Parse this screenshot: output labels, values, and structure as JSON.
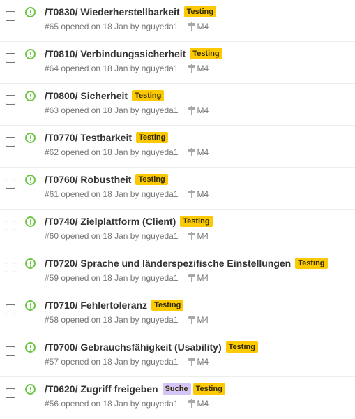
{
  "colors": {
    "open_icon": "#6cc644",
    "testing_label_bg": "#fbca04",
    "testing_label_fg": "#332900",
    "suche_label_bg": "#d4c5f9",
    "suche_label_fg": "#332900"
  },
  "issues": [
    {
      "title": "/T0830/ Wiederherstellbarkeit",
      "meta": "#65 opened on 18 Jan by nguyeda1",
      "milestone": "M4",
      "labels": [
        {
          "text": "Testing",
          "bg": "#fbca04",
          "fg": "#332900"
        }
      ]
    },
    {
      "title": "/T0810/ Verbindungssicherheit",
      "meta": "#64 opened on 18 Jan by nguyeda1",
      "milestone": "M4",
      "labels": [
        {
          "text": "Testing",
          "bg": "#fbca04",
          "fg": "#332900"
        }
      ]
    },
    {
      "title": "/T0800/ Sicherheit",
      "meta": "#63 opened on 18 Jan by nguyeda1",
      "milestone": "M4",
      "labels": [
        {
          "text": "Testing",
          "bg": "#fbca04",
          "fg": "#332900"
        }
      ]
    },
    {
      "title": "/T0770/ Testbarkeit",
      "meta": "#62 opened on 18 Jan by nguyeda1",
      "milestone": "M4",
      "labels": [
        {
          "text": "Testing",
          "bg": "#fbca04",
          "fg": "#332900"
        }
      ]
    },
    {
      "title": "/T0760/ Robustheit",
      "meta": "#61 opened on 18 Jan by nguyeda1",
      "milestone": "M4",
      "labels": [
        {
          "text": "Testing",
          "bg": "#fbca04",
          "fg": "#332900"
        }
      ]
    },
    {
      "title": "/T0740/ Zielplattform (Client)",
      "meta": "#60 opened on 18 Jan by nguyeda1",
      "milestone": "M4",
      "labels": [
        {
          "text": "Testing",
          "bg": "#fbca04",
          "fg": "#332900"
        }
      ]
    },
    {
      "title": "/T0720/ Sprache und länderspezifische Einstellungen",
      "meta": "#59 opened on 18 Jan by nguyeda1",
      "milestone": "M4",
      "labels": [
        {
          "text": "Testing",
          "bg": "#fbca04",
          "fg": "#332900"
        }
      ]
    },
    {
      "title": "/T0710/ Fehlertoleranz",
      "meta": "#58 opened on 18 Jan by nguyeda1",
      "milestone": "M4",
      "labels": [
        {
          "text": "Testing",
          "bg": "#fbca04",
          "fg": "#332900"
        }
      ]
    },
    {
      "title": "/T0700/ Gebrauchsfähigkeit (Usability)",
      "meta": "#57 opened on 18 Jan by nguyeda1",
      "milestone": "M4",
      "labels": [
        {
          "text": "Testing",
          "bg": "#fbca04",
          "fg": "#332900"
        }
      ]
    },
    {
      "title": "/T0620/ Zugriff freigeben",
      "meta": "#56 opened on 18 Jan by nguyeda1",
      "milestone": "M4",
      "labels": [
        {
          "text": "Suche",
          "bg": "#d4c5f9",
          "fg": "#332900"
        },
        {
          "text": "Testing",
          "bg": "#fbca04",
          "fg": "#332900"
        }
      ]
    }
  ]
}
